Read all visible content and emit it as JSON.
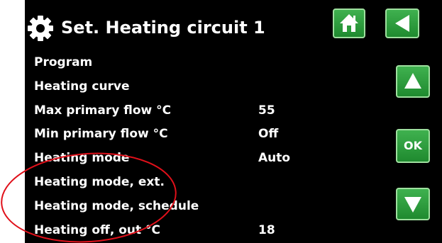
{
  "header": {
    "title": "Set. Heating circuit 1",
    "gear_icon": "gear-icon",
    "home_icon": "home-icon",
    "back_icon": "back-arrow-icon"
  },
  "nav": {
    "up_icon": "up-arrow-icon",
    "ok_label": "OK",
    "down_icon": "down-arrow-icon"
  },
  "menu": {
    "items": [
      {
        "label": "Program",
        "value": ""
      },
      {
        "label": "Heating curve",
        "value": ""
      },
      {
        "label": "Max primary flow °C",
        "value": "55"
      },
      {
        "label": "Min primary flow °C",
        "value": "Off"
      },
      {
        "label": "Heating mode",
        "value": "Auto"
      },
      {
        "label": "Heating mode, ext.",
        "value": ""
      },
      {
        "label": "Heating mode, schedule",
        "value": ""
      },
      {
        "label": "Heating off, out °C",
        "value": "18"
      }
    ]
  },
  "colors": {
    "background": "#000000",
    "text": "#ffffff",
    "button_green": "#2a9b3a",
    "annotation_red": "#e0101a"
  }
}
